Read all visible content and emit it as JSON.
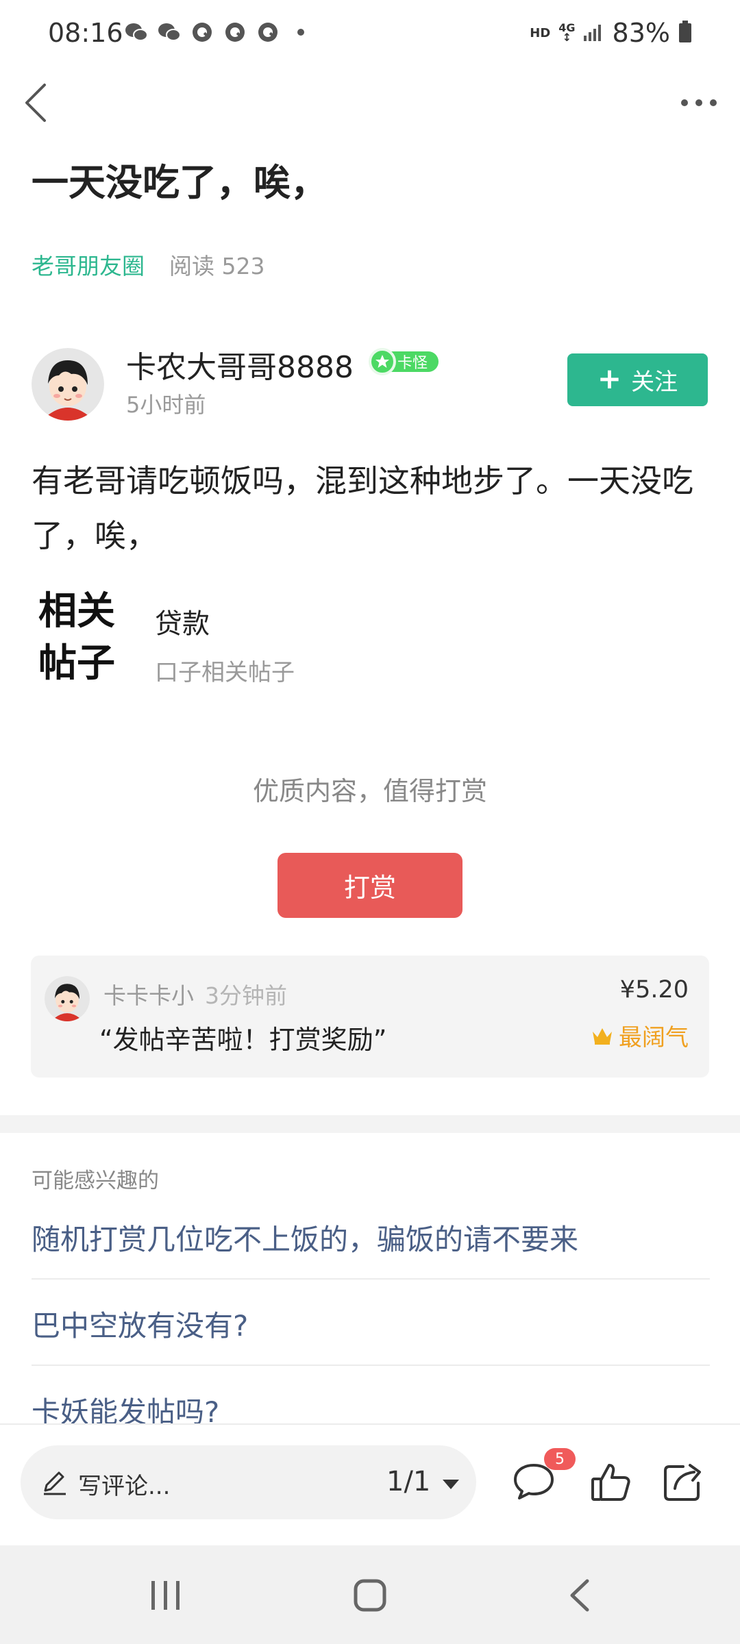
{
  "status_bar": {
    "time": "08:16",
    "notification_icons": [
      "wechat-icon",
      "wechat-icon",
      "q-app-icon",
      "q-app-icon",
      "q-app-icon",
      "more-dot-icon"
    ],
    "hd": "HD",
    "network": "4G",
    "battery": "83%"
  },
  "nav": {
    "back_icon": "back-chevron-icon",
    "more_icon": "more-dots-icon"
  },
  "post": {
    "title": "一天没吃了，唉，",
    "circle": "老哥朋友圈",
    "reads": "阅读 523",
    "body": "有老哥请吃顿饭吗，混到这种地步了。一天没吃了，唉，"
  },
  "author": {
    "name": "卡农大哥哥8888",
    "badge": "卡怪",
    "time": "5小时前",
    "follow_label": "关注"
  },
  "related": {
    "label_line1": "相关",
    "label_line2": "帖子",
    "topic": "贷款",
    "subtitle": "口子相关帖子"
  },
  "reward": {
    "tip": "优质内容，值得打赏",
    "button": "打赏",
    "record": {
      "name": "卡卡卡小",
      "time": "3分钟前",
      "message": "“发帖辛苦啦！打赏奖励”",
      "amount": "¥5.20",
      "tag": "最阔气"
    }
  },
  "interest": {
    "header": "可能感兴趣的",
    "items": [
      "随机打赏几位吃不上饭的，骗饭的请不要来",
      "巴中空放有没有?",
      "卡妖能发帖吗?"
    ]
  },
  "bottom_bar": {
    "comment_placeholder": "写评论...",
    "page_indicator": "1/1",
    "comment_count": "5"
  },
  "colors": {
    "accent_green": "#2db78f",
    "reward_red": "#e85a58",
    "link_blue": "#4a5f86",
    "gold": "#f0a020"
  }
}
